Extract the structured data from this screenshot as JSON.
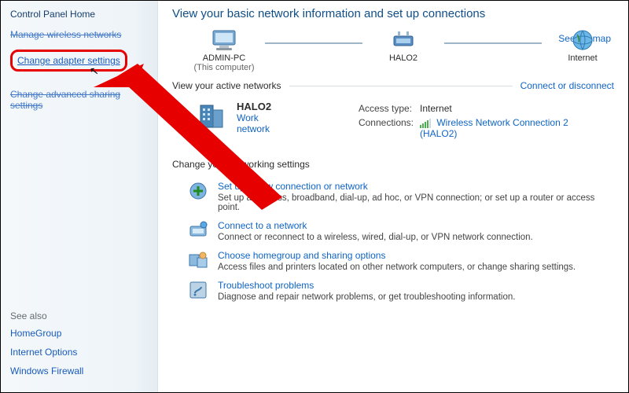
{
  "sidebar": {
    "home": "Control Panel Home",
    "links": [
      {
        "label": "Manage wireless networks"
      },
      {
        "label": "Change adapter settings"
      },
      {
        "label": "Change advanced sharing settings"
      }
    ],
    "see_also_label": "See also",
    "see_also": [
      {
        "label": "HomeGroup"
      },
      {
        "label": "Internet Options"
      },
      {
        "label": "Windows Firewall"
      }
    ]
  },
  "main": {
    "title": "View your basic network information and set up connections",
    "see_full_map": "See full map",
    "nodes": {
      "pc_label": "ADMIN-PC",
      "pc_sub": "(This computer)",
      "middle_label": "HALO2",
      "internet_label": "Internet"
    },
    "active_header": "View your active networks",
    "connect_disconnect": "Connect or disconnect",
    "active": {
      "name": "HALO2",
      "type": "Work network",
      "access_key": "Access type:",
      "access_val": "Internet",
      "conn_key": "Connections:",
      "conn_val": "Wireless Network Connection 2 (HALO2)"
    },
    "change_header": "Change your networking settings",
    "items": [
      {
        "title": "Set up a new connection or network",
        "desc": "Set up a wireless, broadband, dial-up, ad hoc, or VPN connection; or set up a router or access point."
      },
      {
        "title": "Connect to a network",
        "desc": "Connect or reconnect to a wireless, wired, dial-up, or VPN network connection."
      },
      {
        "title": "Choose homegroup and sharing options",
        "desc": "Access files and printers located on other network computers, or change sharing settings."
      },
      {
        "title": "Troubleshoot problems",
        "desc": "Diagnose and repair network problems, or get troubleshooting information."
      }
    ]
  }
}
